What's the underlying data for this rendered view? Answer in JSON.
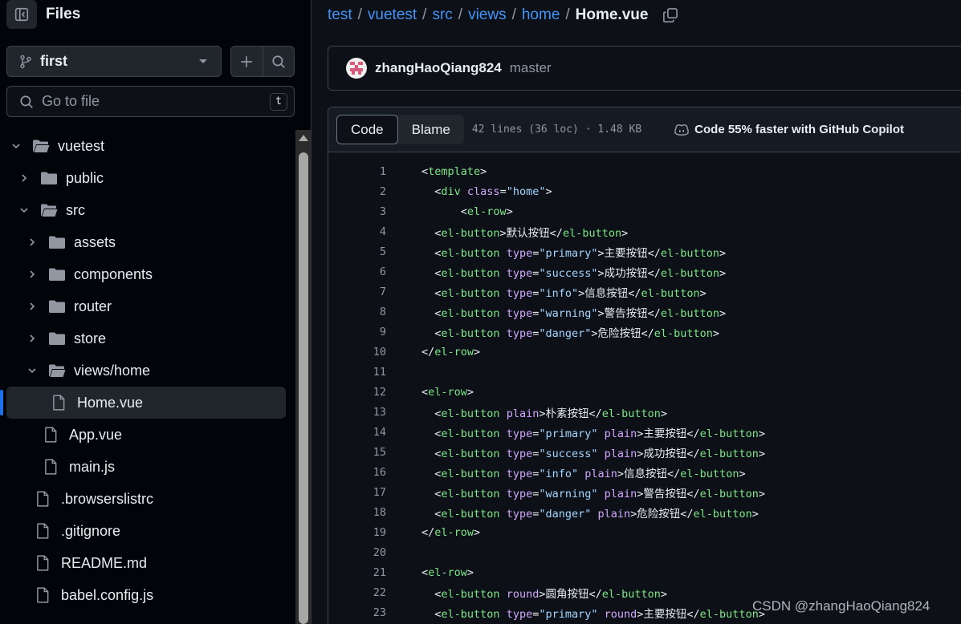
{
  "sidebar": {
    "title": "Files",
    "branch": "first",
    "goto_placeholder": "Go to file",
    "goto_shortcut": "t",
    "tree": [
      {
        "name": "vuetest",
        "type": "folder",
        "level": 0,
        "expanded": true
      },
      {
        "name": "public",
        "type": "folder",
        "level": 1,
        "expanded": false
      },
      {
        "name": "src",
        "type": "folder",
        "level": 1,
        "expanded": true
      },
      {
        "name": "assets",
        "type": "folder",
        "level": 2,
        "expanded": false
      },
      {
        "name": "components",
        "type": "folder",
        "level": 2,
        "expanded": false
      },
      {
        "name": "router",
        "type": "folder",
        "level": 2,
        "expanded": false
      },
      {
        "name": "store",
        "type": "folder",
        "level": 2,
        "expanded": false
      },
      {
        "name": "views/home",
        "type": "folder",
        "level": 2,
        "expanded": true
      },
      {
        "name": "Home.vue",
        "type": "file",
        "level": 3,
        "active": true
      },
      {
        "name": "App.vue",
        "type": "file",
        "level": 2
      },
      {
        "name": "main.js",
        "type": "file",
        "level": 2
      },
      {
        "name": ".browserslistrc",
        "type": "file",
        "level": 1
      },
      {
        "name": ".gitignore",
        "type": "file",
        "level": 1
      },
      {
        "name": "README.md",
        "type": "file",
        "level": 1
      },
      {
        "name": "babel.config.js",
        "type": "file",
        "level": 1
      }
    ]
  },
  "breadcrumb": {
    "parts": [
      "test",
      "vuetest",
      "src",
      "views",
      "home"
    ],
    "current": "Home.vue"
  },
  "commit": {
    "user": "zhangHaoQiang824",
    "branch": "master"
  },
  "code_view": {
    "tab_code": "Code",
    "tab_blame": "Blame",
    "info": "42 lines (36 loc) · 1.48 KB",
    "copilot": "Code 55% faster with GitHub Copilot",
    "lines": [
      "<template>",
      "  <div class=\"home\">",
      "      <el-row>",
      "  <el-button>默认按钮</el-button>",
      "  <el-button type=\"primary\">主要按钮</el-button>",
      "  <el-button type=\"success\">成功按钮</el-button>",
      "  <el-button type=\"info\">信息按钮</el-button>",
      "  <el-button type=\"warning\">警告按钮</el-button>",
      "  <el-button type=\"danger\">危险按钮</el-button>",
      "</el-row>",
      "",
      "<el-row>",
      "  <el-button plain>朴素按钮</el-button>",
      "  <el-button type=\"primary\" plain>主要按钮</el-button>",
      "  <el-button type=\"success\" plain>成功按钮</el-button>",
      "  <el-button type=\"info\" plain>信息按钮</el-button>",
      "  <el-button type=\"warning\" plain>警告按钮</el-button>",
      "  <el-button type=\"danger\" plain>危险按钮</el-button>",
      "</el-row>",
      "",
      "<el-row>",
      "  <el-button round>圆角按钮</el-button>",
      "  <el-button type=\"primary\" round>主要按钮</el-button>"
    ]
  },
  "watermark": "CSDN @zhangHaoQiang824",
  "colors": {
    "tag": "#7ee787",
    "attr": "#d2a8ff",
    "string": "#a5d6ff",
    "link": "#4493f8",
    "active_indicator": "#1f6feb"
  }
}
